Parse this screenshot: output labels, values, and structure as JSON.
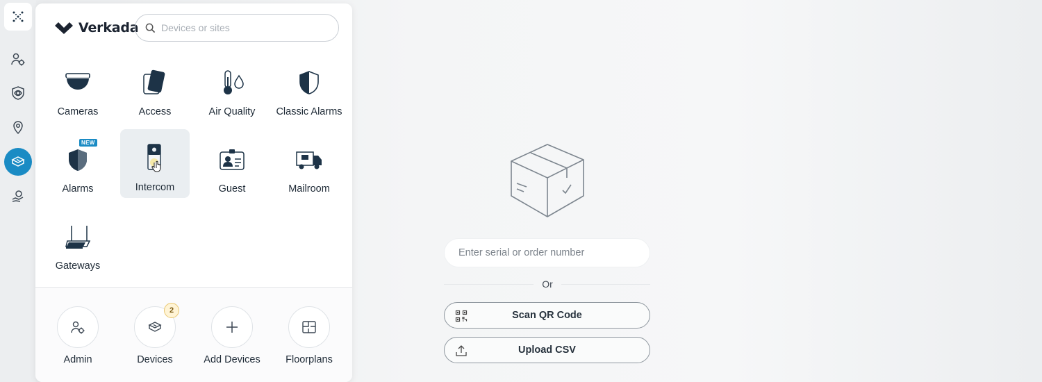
{
  "brand": {
    "name": "Verkada"
  },
  "search": {
    "placeholder": "Devices or sites"
  },
  "apps": [
    {
      "label": "Cameras",
      "icon": "camera-icon"
    },
    {
      "label": "Access",
      "icon": "access-card-icon"
    },
    {
      "label": "Air Quality",
      "icon": "air-quality-icon"
    },
    {
      "label": "Classic Alarms",
      "icon": "classic-alarms-icon"
    },
    {
      "label": "Alarms",
      "icon": "alarms-shield-icon",
      "badge": "NEW"
    },
    {
      "label": "Intercom",
      "icon": "intercom-icon",
      "selected": true
    },
    {
      "label": "Guest",
      "icon": "guest-badge-icon"
    },
    {
      "label": "Mailroom",
      "icon": "mail-truck-icon"
    },
    {
      "label": "Gateways",
      "icon": "gateway-icon"
    }
  ],
  "quick_actions": [
    {
      "label": "Admin",
      "icon": "admin-gear-icon"
    },
    {
      "label": "Devices",
      "icon": "devices-icon",
      "count": "2"
    },
    {
      "label": "Add Devices",
      "icon": "plus-icon"
    },
    {
      "label": "Floorplans",
      "icon": "floorplan-icon"
    }
  ],
  "right": {
    "serial_placeholder": "Enter serial or order number",
    "or_text": "Or",
    "scan_label": "Scan QR Code",
    "upload_label": "Upload CSV"
  },
  "colors": {
    "accent": "#1a8bc4",
    "icon_dark": "#1d3347",
    "new_badge": "#1a8bc4"
  }
}
